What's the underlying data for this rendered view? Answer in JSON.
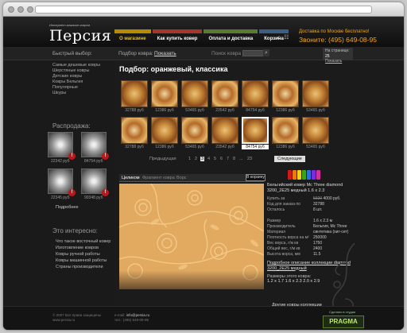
{
  "header": {
    "logo_tagline": "Интернет-магазин ковров",
    "logo": "Персия",
    "nav": [
      "О магазине",
      "Как купить ковер",
      "Оплата и доставка",
      "Корзина"
    ],
    "promo_line1": "Доставка по Москве бесплатно!",
    "promo_line2": "Звоните: (495) 649-08-95"
  },
  "band": {
    "quick_select": "Быстрый выбор:",
    "filter_label": "Подбор ковра:",
    "filter_link": "Показать",
    "search_label": "Поиск ковра",
    "onpage_label": "На странице:",
    "onpage_value": "25",
    "onpage_show": "Показать"
  },
  "sidebar": {
    "links": [
      "Самые дешевые ковры",
      "Шерстяные ковры",
      "Детские ковры",
      "Ковры Бельгия",
      "Популярные",
      "Шкуры"
    ],
    "sale_title": "Распродажа:",
    "sale_prices": [
      "22342 руб",
      "84754 руб",
      "22345 руб",
      "90348 руб"
    ],
    "more": "Подробнее",
    "interest_title": "Это интересно:",
    "interest_links": [
      "Что такое восточный ковер",
      "Изготовление ковров",
      "Ковры ручной работы",
      "Ковры машинной работы",
      "Страны производители"
    ]
  },
  "main": {
    "title": "Подбор: оранжевый, классика",
    "row1_prices": [
      "32788 руб",
      "12386 руб",
      "53465 руб",
      "23542 руб",
      "84754 руб",
      "12386 руб",
      "53465 руб"
    ],
    "row2_prices": [
      "32788 руб",
      "12386 руб",
      "53465 руб",
      "23542 руб",
      "84754 руб",
      "12386 руб",
      "53465 руб"
    ],
    "pager_prev": "Предыдущая",
    "pages": [
      "1",
      "2",
      "3",
      "4",
      "5",
      "6",
      "7",
      "8",
      "...",
      "23"
    ],
    "current_page": "3",
    "pager_next": "Следующие",
    "view_tabs": [
      "Целиком",
      "Фрагмент ковра",
      "Ворс"
    ],
    "cart_button": "В корзину",
    "swatch_colors": [
      "#d01919",
      "#e87a12",
      "#f2d018",
      "#3aa51c",
      "#2e6fd8",
      "#7a2ed8",
      "#d12ea0"
    ]
  },
  "details": {
    "title": "Бельгийский ковер Mc Three diamond 3200_2E25 медный 1.6 x 2.3",
    "rows": [
      {
        "k": "Купить за",
        "old": "5920",
        "v": "4000 руб."
      },
      {
        "k": "Код для заказа по",
        "v": "32788"
      },
      {
        "k": "Осталось",
        "v": "8 шт."
      },
      {
        "k": "",
        "v": ""
      },
      {
        "k": "Размер",
        "v": "1.6 x 2.3 м"
      },
      {
        "k": "Производитель",
        "v": "Бельгия, Mc Three"
      },
      {
        "k": "Материал",
        "v": "синтетика (хит-сет)"
      },
      {
        "k": "Плотность ворса на м²",
        "v": "250000"
      },
      {
        "k": "Вес ворса, г/м кв",
        "v": "1750"
      },
      {
        "k": "Общий вес, г/м кв",
        "v": "2400"
      },
      {
        "k": "Высота ворса, мм",
        "v": "11.5"
      }
    ],
    "desc_link": "Подробное описание коллекции diamond 3200_2E25 медный",
    "sizes_label": "Размеры этого ковра:",
    "sizes": "1.2 x 1.7   1.6 x 2.3   2.0 x 2.9",
    "other_link": "Другие ковры коллекции"
  },
  "footer": {
    "copy1": "© 2007 Все права защищены",
    "copy2": "www.persia.ru",
    "email_label": "e-mail:",
    "email": "info@persia.ru",
    "phone_label": "тел.:",
    "phone": "(495) 649-08-95",
    "studio": "Сделано в студии",
    "pragma": "PRAGMA"
  }
}
